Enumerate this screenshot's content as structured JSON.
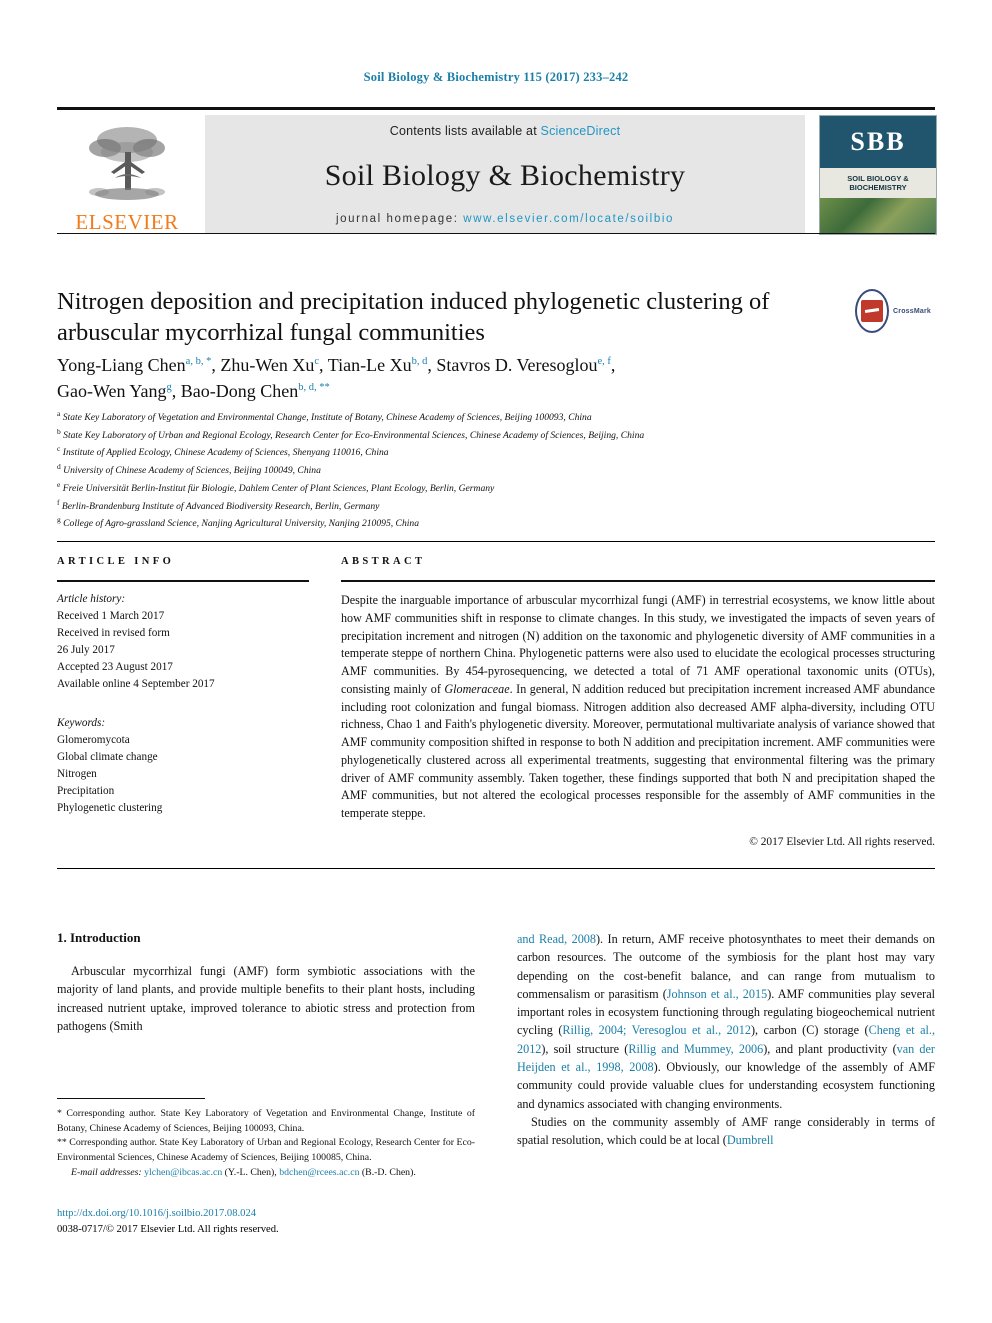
{
  "running_head": "Soil Biology & Biochemistry 115 (2017) 233–242",
  "masthead": {
    "contents_prefix": "Contents lists available at ",
    "sciencedirect": "ScienceDirect",
    "journal_name": "Soil Biology & Biochemistry",
    "homepage_prefix": "journal homepage: ",
    "homepage_url": "www.elsevier.com/locate/soilbio",
    "publisher": "ELSEVIER",
    "publisher_logo_icon": "elsevier-tree-icon",
    "cover_monogram": "SBB",
    "cover_title": "SOIL BIOLOGY &\nBIOCHEMISTRY",
    "accent_blue": "#2196c4",
    "elsevier_orange": "#f07c1b"
  },
  "crossmark": {
    "label": "CrossMark",
    "icon": "crossmark-icon"
  },
  "article": {
    "title": "Nitrogen deposition and precipitation induced phylogenetic clustering of arbuscular mycorrhizal fungal communities",
    "authors_line_1_parts": [
      {
        "name": "Yong-Liang Chen",
        "sup": "a, b, *"
      },
      {
        "name": "Zhu-Wen Xu",
        "sup": "c"
      },
      {
        "name": "Tian-Le Xu",
        "sup": "b, d"
      },
      {
        "name": "Stavros D. Veresoglou",
        "sup": "e, f"
      }
    ],
    "authors_line_2_parts": [
      {
        "name": "Gao-Wen Yang",
        "sup": "g"
      },
      {
        "name": "Bao-Dong Chen",
        "sup": "b, d, **"
      }
    ],
    "affiliations": [
      {
        "mark": "a",
        "text": "State Key Laboratory of Vegetation and Environmental Change, Institute of Botany, Chinese Academy of Sciences, Beijing 100093, China"
      },
      {
        "mark": "b",
        "text": "State Key Laboratory of Urban and Regional Ecology, Research Center for Eco-Environmental Sciences, Chinese Academy of Sciences, Beijing, China"
      },
      {
        "mark": "c",
        "text": "Institute of Applied Ecology, Chinese Academy of Sciences, Shenyang 110016, China"
      },
      {
        "mark": "d",
        "text": "University of Chinese Academy of Sciences, Beijing 100049, China"
      },
      {
        "mark": "e",
        "text": "Freie Universität Berlin-Institut für Biologie, Dahlem Center of Plant Sciences, Plant Ecology, Berlin, Germany"
      },
      {
        "mark": "f",
        "text": "Berlin-Brandenburg Institute of Advanced Biodiversity Research, Berlin, Germany"
      },
      {
        "mark": "g",
        "text": "College of Agro-grassland Science, Nanjing Agricultural University, Nanjing 210095, China"
      }
    ]
  },
  "article_info": {
    "heading": "ARTICLE INFO",
    "history_label": "Article history:",
    "history": [
      "Received 1 March 2017",
      "Received in revised form",
      "26 July 2017",
      "Accepted 23 August 2017",
      "Available online 4 September 2017"
    ],
    "keywords_label": "Keywords:",
    "keywords": [
      "Glomeromycota",
      "Global climate change",
      "Nitrogen",
      "Precipitation",
      "Phylogenetic clustering"
    ]
  },
  "abstract": {
    "heading": "ABSTRACT",
    "text": "Despite the inarguable importance of arbuscular mycorrhizal fungi (AMF) in terrestrial ecosystems, we know little about how AMF communities shift in response to climate changes. In this study, we investigated the impacts of seven years of precipitation increment and nitrogen (N) addition on the taxonomic and phylogenetic diversity of AMF communities in a temperate steppe of northern China. Phylogenetic patterns were also used to elucidate the ecological processes structuring AMF communities. By 454-pyrosequencing, we detected a total of 71 AMF operational taxonomic units (OTUs), consisting mainly of Glomeraceae. In general, N addition reduced but precipitation increment increased AMF abundance including root colonization and fungal biomass. Nitrogen addition also decreased AMF alpha-diversity, including OTU richness, Chao 1 and Faith's phylogenetic diversity. Moreover, permutational multivariate analysis of variance showed that AMF community composition shifted in response to both N addition and precipitation increment. AMF communities were phylogenetically clustered across all experimental treatments, suggesting that environmental filtering was the primary driver of AMF community assembly. Taken together, these findings supported that both N and precipitation shaped the AMF communities, but not altered the ecological processes responsible for the assembly of AMF communities in the temperate steppe.",
    "italic_term": "Glomeraceae",
    "copyright": "© 2017 Elsevier Ltd. All rights reserved."
  },
  "body": {
    "section_heading": "1. Introduction",
    "left_paragraph": "Arbuscular mycorrhizal fungi (AMF) form symbiotic associations with the majority of land plants, and provide multiple benefits to their plant hosts, including increased nutrient uptake, improved tolerance to abiotic stress and protection from pathogens (Smith",
    "left_paragraph_link": "Smith",
    "right_paragraph_1": "and Read, 2008). In return, AMF receive photosynthates to meet their demands on carbon resources. The outcome of the symbiosis for the plant host may vary depending on the cost-benefit balance, and can range from mutualism to commensalism or parasitism (Johnson et al., 2015). AMF communities play several important roles in ecosystem functioning through regulating biogeochemical nutrient cycling (Rillig, 2004; Veresoglou et al., 2012), carbon (C) storage (Cheng et al., 2012), soil structure (Rillig and Mummey, 2006), and plant productivity (van der Heijden et al., 1998, 2008). Obviously, our knowledge of the assembly of AMF community could provide valuable clues for understanding ecosystem functioning and dynamics associated with changing environments.",
    "right_paragraph_2": "Studies on the community assembly of AMF range considerably in terms of spatial resolution, which could be at local (Dumbrell",
    "citations": [
      "and Read, 2008",
      "Johnson et al., 2015",
      "Rillig, 2004; Veresoglou et al., 2012",
      "Cheng et al., 2012",
      "Rillig and Mummey, 2006",
      "van der Heijden et al., 1998, 2008",
      "Dumbrell"
    ]
  },
  "footnotes": {
    "note_1": "* Corresponding author. State Key Laboratory of Vegetation and Environmental Change, Institute of Botany, Chinese Academy of Sciences, Beijing 100093, China.",
    "note_2": "** Corresponding author. State Key Laboratory of Urban and Regional Ecology, Research Center for Eco-Environmental Sciences, Chinese Academy of Sciences, Beijing 100085, China.",
    "email_label": "E-mail addresses:",
    "email_1": "ylchen@ibcas.ac.cn",
    "email_1_owner": "(Y.-L. Chen),",
    "email_2": "bdchen@rcees.ac.cn",
    "email_2_owner": "(B.-D. Chen)."
  },
  "bottom": {
    "doi": "http://dx.doi.org/10.1016/j.soilbio.2017.08.024",
    "issn_line": "0038-0717/© 2017 Elsevier Ltd. All rights reserved."
  }
}
